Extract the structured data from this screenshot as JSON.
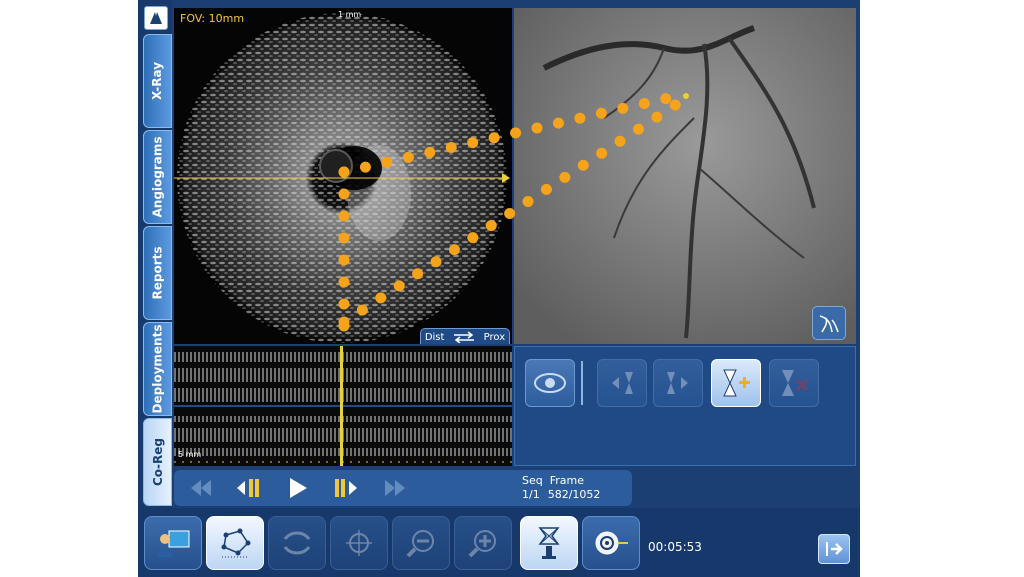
{
  "tabs": [
    {
      "label": "X-Ray"
    },
    {
      "label": "Angiograms"
    },
    {
      "label": "Reports"
    },
    {
      "label": "Deployments"
    },
    {
      "label": "Co-Reg",
      "active": true
    }
  ],
  "ivus": {
    "fov": "FOV: 10mm",
    "scale": "1 mm"
  },
  "longitudinal": {
    "scale": "5 mm",
    "dist": "Dist",
    "prox": "Prox"
  },
  "navigation": {
    "seq_label": "Seq",
    "frame_label": "Frame",
    "seq_value": "1/1",
    "frame_value": "582/1052"
  },
  "status": {
    "time": "00:05:53"
  },
  "colors": {
    "accent": "#f5a31a",
    "panel": "#1b3f73",
    "marker": "#f0d020"
  },
  "icons": [
    "logo-icon",
    "eye-icon",
    "prev-mark-icon",
    "next-mark-icon",
    "add-mark-icon",
    "delete-mark-icon",
    "vessel-icon",
    "first-frame-icon",
    "step-back-icon",
    "play-icon",
    "step-forward-icon",
    "last-frame-icon",
    "user-monitor-icon",
    "polygon-icon",
    "sync-icon",
    "crosshair-icon",
    "zoom-out-icon",
    "zoom-in-icon",
    "stent-icon",
    "pullback-device-icon",
    "exit-icon"
  ]
}
